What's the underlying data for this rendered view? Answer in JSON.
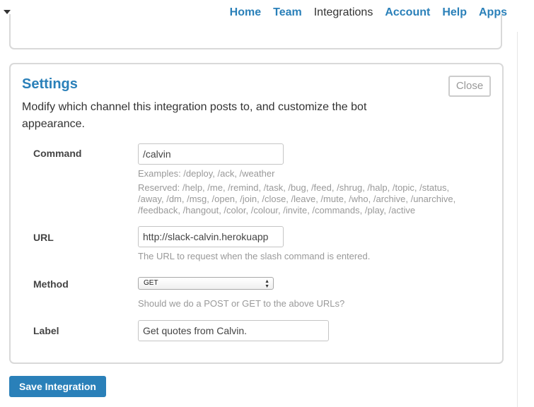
{
  "nav": {
    "items": [
      {
        "label": "Home"
      },
      {
        "label": "Team"
      },
      {
        "label": "Integrations"
      },
      {
        "label": "Account"
      },
      {
        "label": "Help"
      },
      {
        "label": "Apps"
      }
    ],
    "current": "Integrations"
  },
  "settings": {
    "title": "Settings",
    "close_label": "Close",
    "description": "Modify which channel this integration posts to, and customize the bot appearance.",
    "command": {
      "label": "Command",
      "value": "/calvin",
      "examples": "Examples: /deploy, /ack, /weather",
      "reserved": "Reserved: /help, /me, /remind, /task, /bug, /feed, /shrug, /halp, /topic, /status, /away, /dm, /msg, /open, /join, /close, /leave, /mute, /who, /archive, /unarchive, /feedback, /hangout, /color, /colour, /invite, /commands, /play, /active"
    },
    "url": {
      "label": "URL",
      "value": "http://slack-calvin.herokuapp",
      "hint": "The URL to request when the slash command is entered."
    },
    "method": {
      "label": "Method",
      "value": "GET",
      "hint": "Should we do a POST or GET to the above URLs?"
    },
    "label_field": {
      "label": "Label",
      "value": "Get quotes from Calvin."
    }
  },
  "save_label": "Save Integration",
  "colors": {
    "link": "#2a80b9",
    "button": "#2a80b9",
    "hint": "#999999"
  }
}
